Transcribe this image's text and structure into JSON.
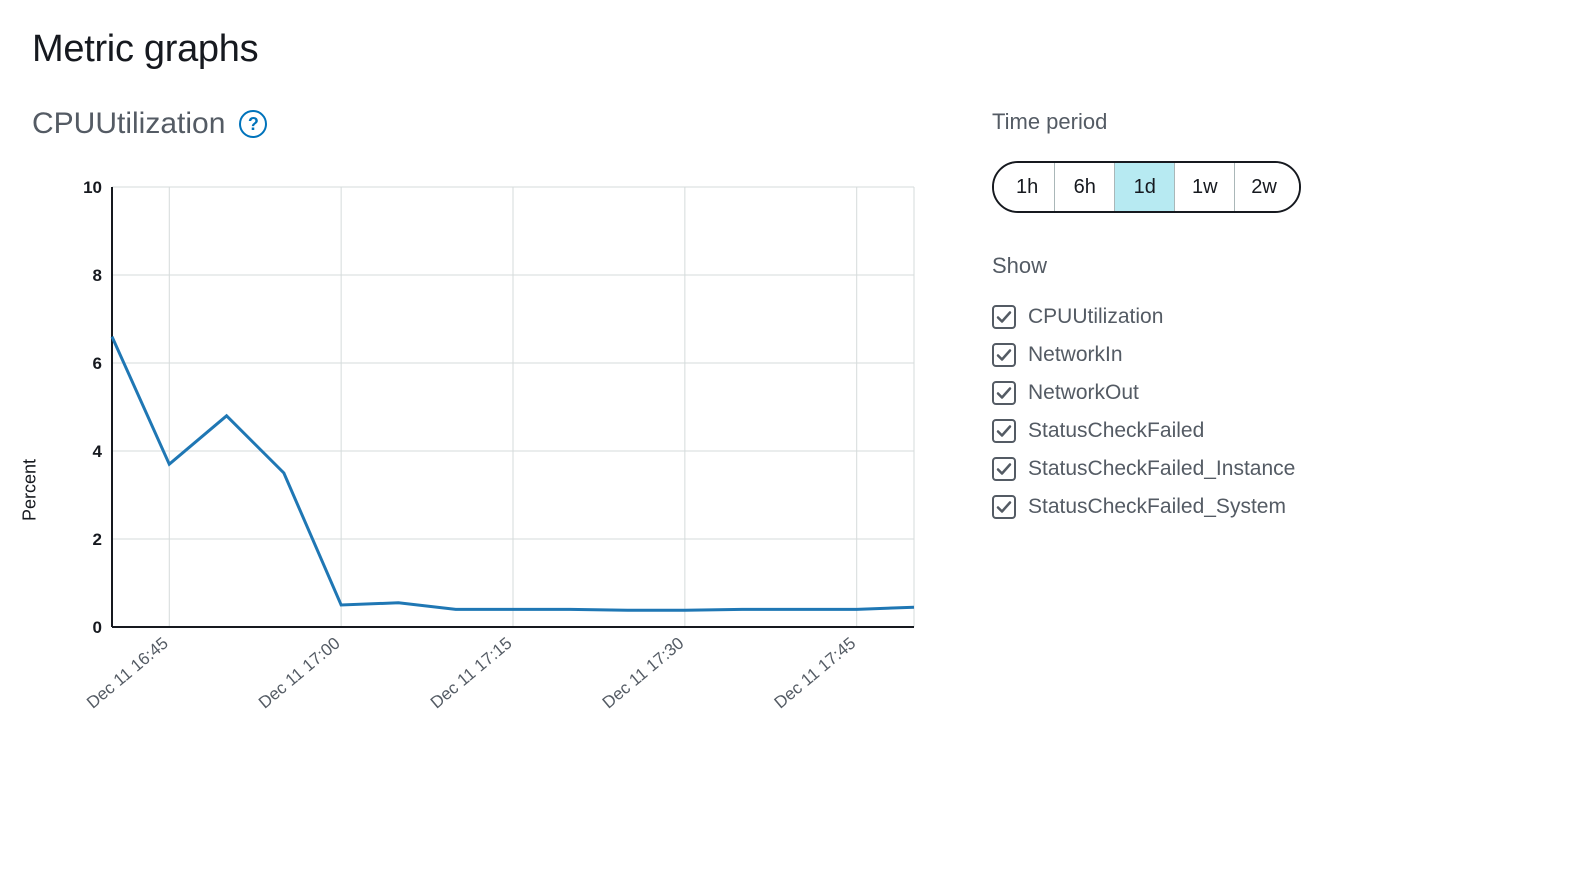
{
  "page_title": "Metric graphs",
  "chart_title": "CPUUtilization",
  "y_axis_label": "Percent",
  "time_period": {
    "label": "Time period",
    "options": [
      "1h",
      "6h",
      "1d",
      "1w",
      "2w"
    ],
    "selected": "1d"
  },
  "show": {
    "label": "Show",
    "items": [
      {
        "label": "CPUUtilization",
        "checked": true
      },
      {
        "label": "NetworkIn",
        "checked": true
      },
      {
        "label": "NetworkOut",
        "checked": true
      },
      {
        "label": "StatusCheckFailed",
        "checked": true
      },
      {
        "label": "StatusCheckFailed_Instance",
        "checked": true
      },
      {
        "label": "StatusCheckFailed_System",
        "checked": true
      }
    ]
  },
  "chart_data": {
    "type": "line",
    "title": "CPUUtilization",
    "xlabel": "",
    "ylabel": "Percent",
    "ylim": [
      0,
      10
    ],
    "y_ticks": [
      0,
      2,
      4,
      6,
      8,
      10
    ],
    "x_tick_labels": [
      "Dec 11 16:45",
      "Dec 11 17:00",
      "Dec 11 17:15",
      "Dec 11 17:30",
      "Dec 11 17:45"
    ],
    "x": [
      0,
      1,
      2,
      3,
      4,
      5,
      6,
      7,
      8,
      9,
      10,
      11,
      12,
      13,
      14
    ],
    "values": [
      6.6,
      3.7,
      4.8,
      3.5,
      0.5,
      0.55,
      0.4,
      0.4,
      0.4,
      0.38,
      0.38,
      0.4,
      0.4,
      0.4,
      0.45
    ],
    "series": [
      {
        "name": "CPUUtilization",
        "values": [
          6.6,
          3.7,
          4.8,
          3.5,
          0.5,
          0.55,
          0.4,
          0.4,
          0.4,
          0.38,
          0.38,
          0.4,
          0.4,
          0.4,
          0.45
        ]
      }
    ],
    "color": "#1f77b4"
  }
}
